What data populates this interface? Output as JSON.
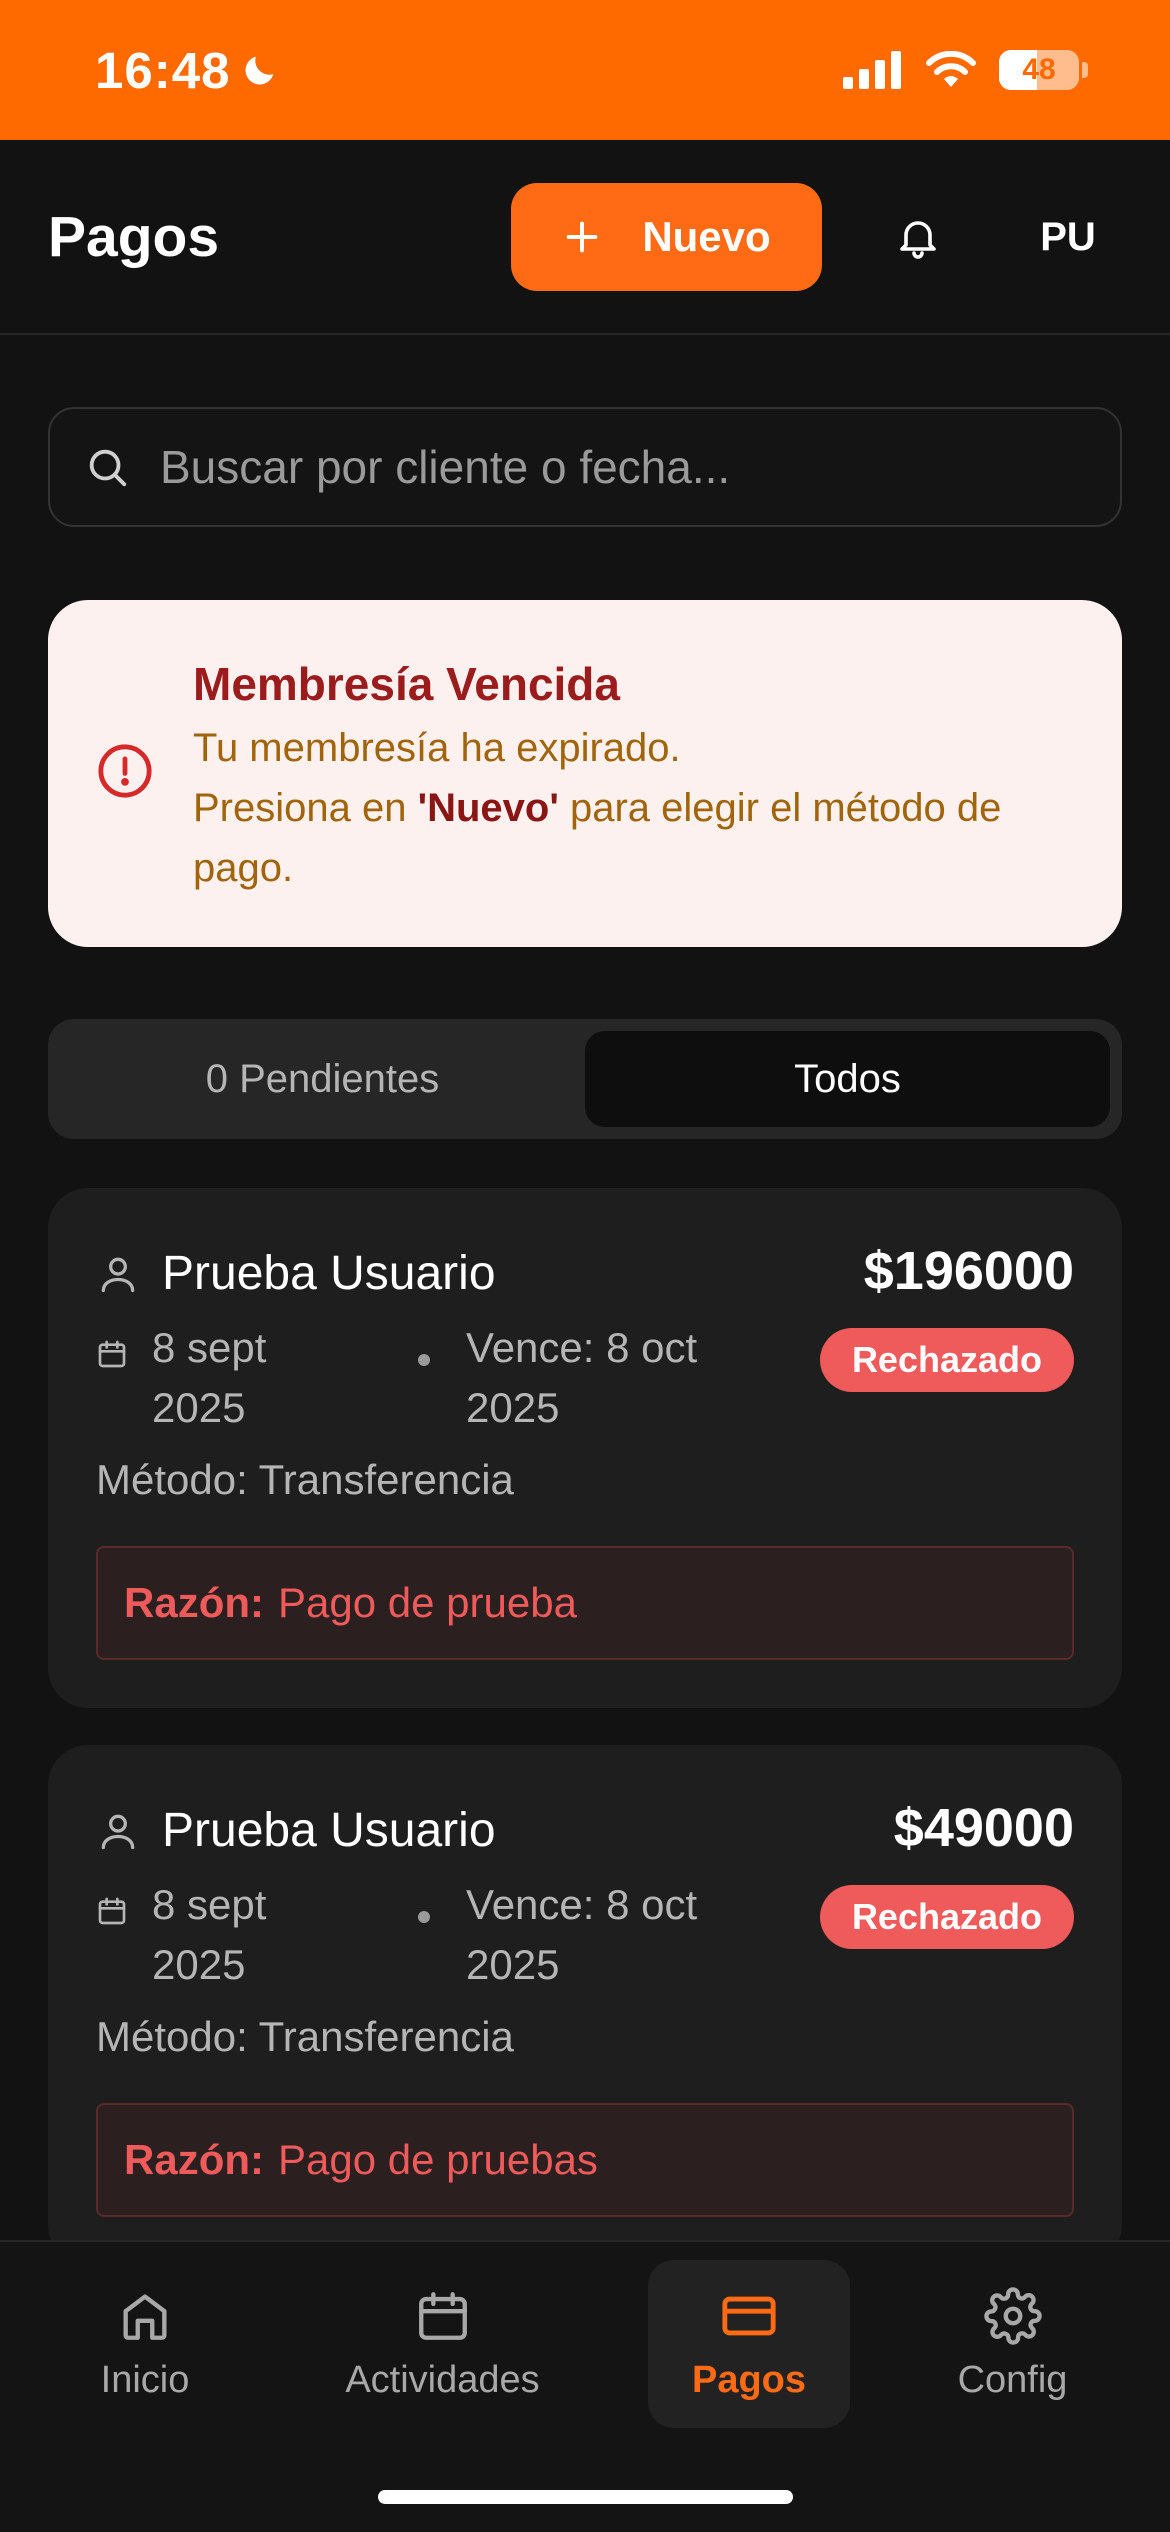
{
  "status_bar": {
    "time": "16:48",
    "battery": "48"
  },
  "header": {
    "title": "Pagos",
    "new_label": "Nuevo",
    "avatar_initials": "PU"
  },
  "search": {
    "placeholder": "Buscar por cliente o fecha..."
  },
  "alert": {
    "title": "Membresía Vencida",
    "line1": "Tu membresía ha expirado.",
    "line2_prefix": "Presiona en ",
    "line2_bold": "'Nuevo'",
    "line2_suffix": " para elegir el método de pago."
  },
  "tabs": [
    {
      "label": "0 Pendientes",
      "active": false
    },
    {
      "label": "Todos",
      "active": true
    }
  ],
  "payments": [
    {
      "client": "Prueba Usuario",
      "amount": "$196000",
      "status": "Rechazado",
      "date_line1": "8 sept",
      "date_line2": "2025",
      "due_line1": "Vence: 8 oct",
      "due_line2": "2025",
      "method": "Método: Transferencia",
      "reason_label": "Razón:",
      "reason_text": "Pago de prueba"
    },
    {
      "client": "Prueba Usuario",
      "amount": "$49000",
      "status": "Rechazado",
      "date_line1": "8 sept",
      "date_line2": "2025",
      "due_line1": "Vence: 8 oct",
      "due_line2": "2025",
      "method": "Método: Transferencia",
      "reason_label": "Razón:",
      "reason_text": "Pago de pruebas"
    }
  ],
  "nav": [
    {
      "label": "Inicio",
      "icon": "home-icon"
    },
    {
      "label": "Actividades",
      "icon": "calendar-icon"
    },
    {
      "label": "Pagos",
      "icon": "credit-card-icon",
      "active": true
    },
    {
      "label": "Config",
      "icon": "gear-icon"
    }
  ],
  "colors": {
    "accent": "#ff6a14",
    "danger": "#ef5a5a",
    "background": "#121212"
  }
}
